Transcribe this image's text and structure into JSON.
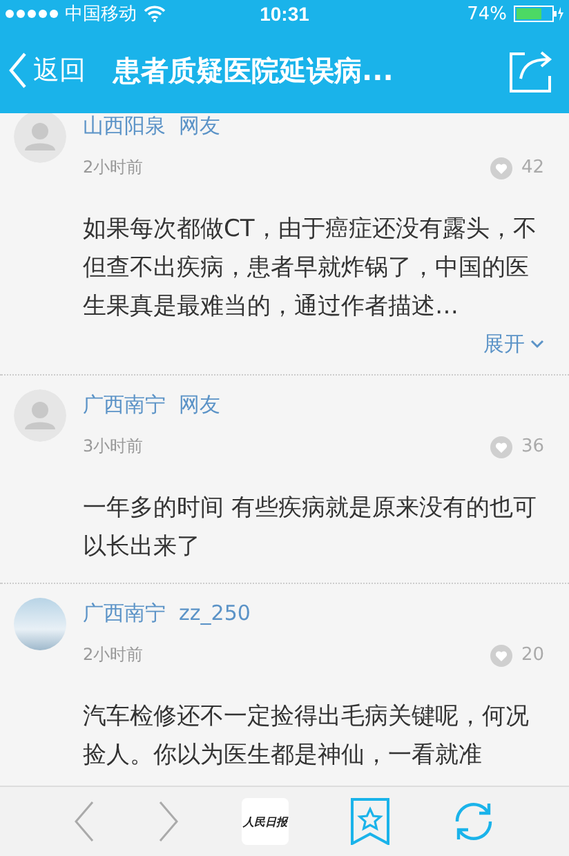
{
  "status_bar": {
    "carrier": "中国移动",
    "time": "10:31",
    "battery": "74%"
  },
  "nav": {
    "back": "返回",
    "title": "患者质疑医院延误病..."
  },
  "comments": [
    {
      "kind": "silhouette",
      "location": "山西阳泉",
      "user": "网友",
      "time": "2小时前",
      "likes": "42",
      "text": "如果每次都做CT，由于癌症还没有露头，不但查不出疾病，患者早就炸锅了，中国的医生果真是最难当的，通过作者描述…",
      "expand": "展开"
    },
    {
      "kind": "silhouette",
      "location": "广西南宁",
      "user": "网友",
      "time": "3小时前",
      "likes": "36",
      "text": "一年多的时间 有些疾病就是原来没有的也可以长出来了"
    },
    {
      "kind": "photo",
      "location": "广西南宁",
      "user": "zz_250",
      "time": "2小时前",
      "likes": "20",
      "text": "汽车检修还不一定捡得出毛病关键呢，何况捡人。你以为医生都是神仙，一看就准"
    }
  ],
  "toolbar": {
    "logo": "人民日报"
  }
}
